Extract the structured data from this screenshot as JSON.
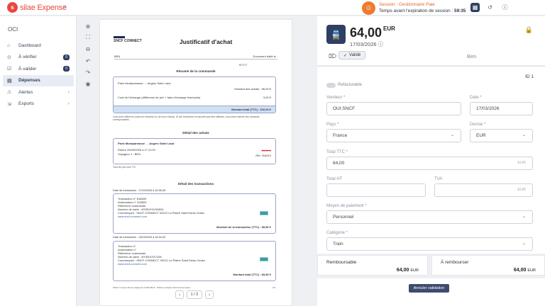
{
  "app": {
    "logo_mark": "s",
    "brand": "silae",
    "product": "Expense",
    "collapse_icon": "double-chevron-left"
  },
  "session": {
    "title": "Session : Gestionnaire Paie",
    "expiry_label": "Temps avant l'expiration de session :",
    "expiry_value": "59:35"
  },
  "sidebar": {
    "org": "OCI",
    "items": [
      {
        "label": "Dashboard",
        "icon": "home-icon",
        "glyph": "⌂",
        "count": "",
        "chevron": ""
      },
      {
        "label": "À vérifier",
        "icon": "search-doc-icon",
        "glyph": "⊙",
        "count": "0",
        "chevron": ""
      },
      {
        "label": "À valider",
        "icon": "checkbox-icon",
        "glyph": "☑",
        "count": "0",
        "chevron": ""
      },
      {
        "label": "Dépenses",
        "icon": "receipt-icon",
        "glyph": "▤",
        "count": "",
        "chevron": ""
      },
      {
        "label": "Alertes",
        "icon": "alert-icon",
        "glyph": "⚠",
        "count": "",
        "chevron": "›"
      },
      {
        "label": "Exports",
        "icon": "export-icon",
        "glyph": "⇲",
        "count": "",
        "chevron": "›"
      }
    ]
  },
  "viewer": {
    "tools": [
      "zoom-in-icon",
      "fit-icon",
      "zoom-out-icon",
      "rotate-left-icon",
      "rotate-right-icon",
      "eye-icon"
    ],
    "page": "1 / 2",
    "prev": "‹",
    "next": "›"
  },
  "document": {
    "logo": "SNCF CONNECT",
    "title": "Justificatif d'achat",
    "ben": "BEN",
    "doc_emitted": "Document édité le :",
    "number": "N°177",
    "summary_title": "Résumé de la commande",
    "route1": "Paris Montparnasse → Angers Saint Laud",
    "purchases_amount": "Montant des achats : 96,00 €",
    "exchange_label": "Coût de l'échange (différence de prix + frais d'échange éventuels)",
    "exchange_value": "3,00 €",
    "summary_total": "Montant total (TTC) : 102,00 €",
    "fine_print": "Vous avez utilisé les codes de réduction ou de bons d'achat. Si ces réductions ne peuvent pas être utilisées, vous serez facturé des montants correspondants.",
    "detail_title": "Détail des achats",
    "route2": "Paris Montparnasse → Angers Saint Laud",
    "departure": "Retour 25/03/2026 à 17:11:00",
    "traveler": "Voyageur 1 : BEN",
    "price_struck": "39,00 €",
    "ref": "Réf. 2NAXX",
    "detail_note": "Tous les prix sont TTC",
    "transactions_title": "Détail des transactions",
    "tx1_date": "Date de transaction : 17/02/2026 à 16:56:28",
    "tx1_lines": [
      "Transaction n° 816609",
      "Autorisation n° 245824",
      "Référence commande",
      "Numéro de carte : 4978XXXXX5604",
      "Commerçant : SNCF CONNECT 93212 La Plaine Saint Denis Cedex",
      "www.sncf-connect.com"
    ],
    "tx1_total": "Montant de la transaction (TTC) : 98,50 €",
    "tx2_date": "Date de transaction : 13/03/2026 à 16:34:20",
    "tx2_lines": [
      "Transaction n°",
      "Autorisation n°",
      "Référence commande",
      "Numéro de carte : 4978XXXX7208",
      "Commerçant : SNCF CONNECT, 93212 La Plaine Saint Denis Cedex",
      "www.sncf-connect.com"
    ],
    "tx2_total": "Montant total (TTC) : 68,50 €",
    "footer": "SNCF Connect SA au capital de 2 500 000 € · 93212 La Plaine Saint Denis Cedex",
    "page_no": "1/2"
  },
  "expense": {
    "icon": "train-icon",
    "amount": "64,00",
    "currency": "EUR",
    "date": "17/03/2026",
    "status": "Validé",
    "owner": "Ben",
    "id_label": "ID 1",
    "refundable_label": "Refacturable"
  },
  "form": {
    "vendor_label": "Vendeur *",
    "vendor_value": "OUI.SNCF",
    "date_label": "Date *",
    "date_value": "17/03/2026",
    "country_label": "Pays *",
    "country_value": "France",
    "currency_label": "Devise *",
    "currency_value": "EUR",
    "ttc_label": "Total TTC *",
    "ttc_value": "64,00",
    "ttc_suffix": "EUR",
    "ht_label": "Total HT",
    "ht_value": "",
    "tva_label": "TVA",
    "tva_value": "",
    "tva_suffix": "EUR",
    "payment_label": "Moyen de paiement *",
    "payment_value": "Personnel",
    "category_label": "Catégorie *",
    "category_value": "Train"
  },
  "summary": {
    "refundable_label": "Remboursable",
    "refundable_value": "64,00",
    "refundable_cur": "EUR",
    "to_refund_label": "À rembourser",
    "to_refund_value": "64,00",
    "to_refund_cur": "EUR"
  },
  "actions": {
    "cancel_validation": "Annuler validation"
  }
}
